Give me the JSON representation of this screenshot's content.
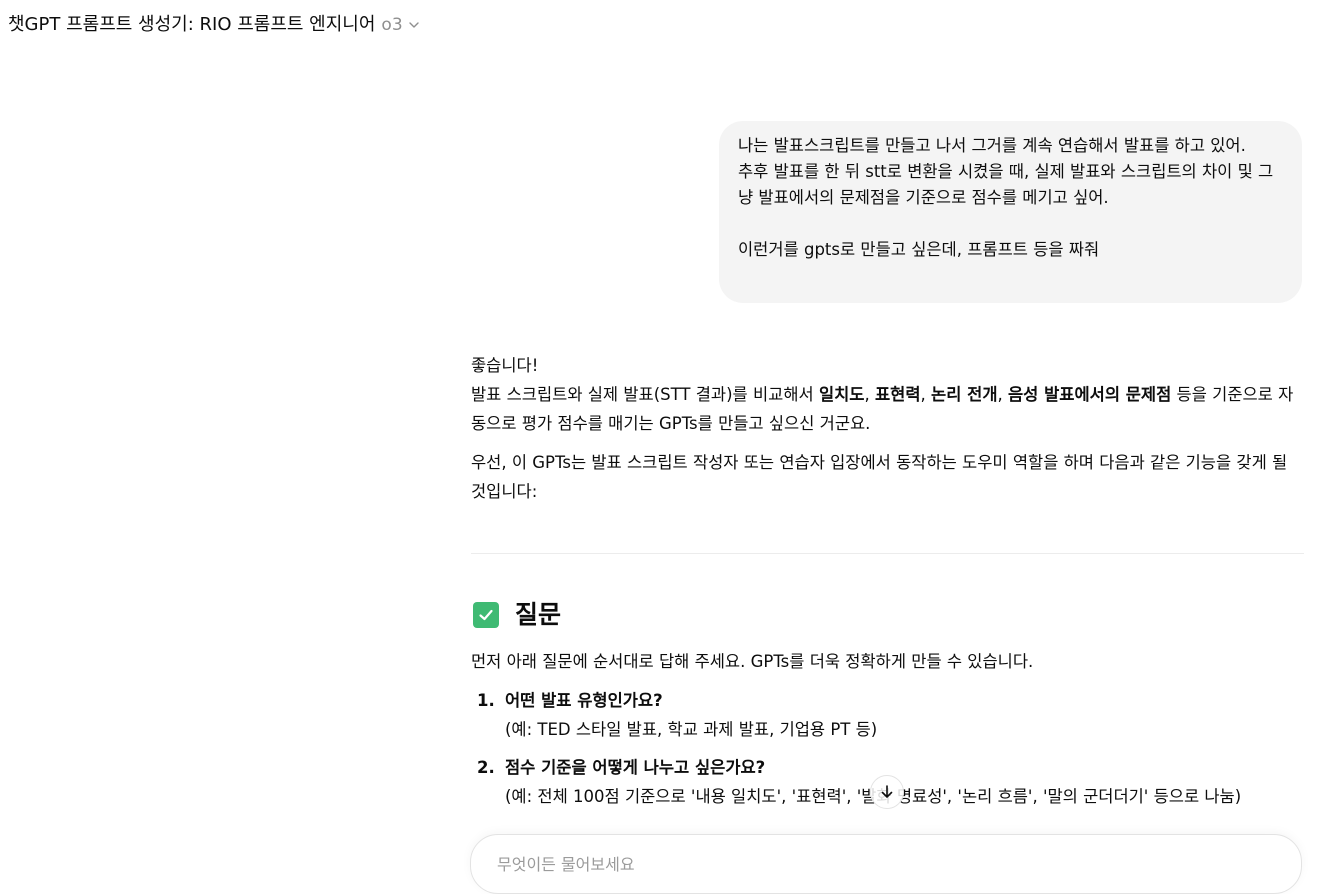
{
  "header": {
    "title": "챗GPT 프롬프트 생성기: RIO 프롬프트 엔지니어",
    "model_version": "o3",
    "dropdown_icon": "chevron-down-icon"
  },
  "user_message": {
    "line1": "나는 발표스크립트를 만들고 나서 그거를 계속 연습해서 발표를 하고 있어.",
    "line2": "추후 발표를 한 뒤 stt로 변환을 시켰을 때, 실제 발표와 스크립트의 차이 및 그냥 발표에서의 문제점을 기준으로 점수를 메기고 싶어.",
    "line3": "이런거를 gpts로 만들고 싶은데, 프롬프트 등을 짜줘"
  },
  "assistant": {
    "greeting": "좋습니다!",
    "para1_prefix": "발표 스크립트와 실제 발표(STT 결과)를 비교해서 ",
    "para1_b1": "일치도",
    "para1_sep1": ", ",
    "para1_b2": "표현력",
    "para1_sep2": ", ",
    "para1_b3": "논리 전개",
    "para1_sep3": ", ",
    "para1_b4": "음성 발표에서의 문제점",
    "para1_suffix": " 등을 기준으로 자동으로 평가 점수를 매기는 GPTs를 만들고 싶으신 거군요.",
    "para2": "우선, 이 GPTs는 발표 스크립트 작성자 또는 연습자 입장에서 동작하는 도우미 역할을 하며 다음과 같은 기능을 갖게 될 것입니다:",
    "section_icon": "check-box-icon",
    "section_title": "질문",
    "questions_intro": "먼저 아래 질문에 순서대로 답해 주세요. GPTs를 더욱 정확하게 만들 수 있습니다.",
    "questions": [
      {
        "number": "1.",
        "title": "어떤 발표 유형인가요?",
        "example": "(예: TED 스타일 발표, 학교 과제 발표, 기업용 PT 등)"
      },
      {
        "number": "2.",
        "title": "점수 기준을 어떻게 나누고 싶은가요?",
        "example": "(예: 전체 100점 기준으로 '내용 일치도', '표현력', '발화 명료성', '논리 흐름', '말의 군더더기' 등으로 나눔)"
      }
    ]
  },
  "scroll_button_icon": "arrow-down-icon",
  "composer": {
    "placeholder": "무엇이든 물어보세요"
  }
}
